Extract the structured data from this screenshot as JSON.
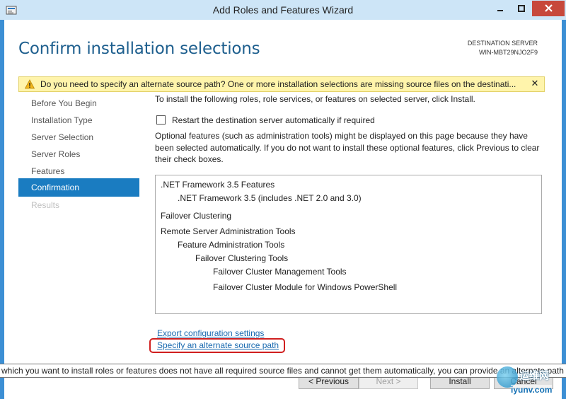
{
  "window": {
    "title": "Add Roles and Features Wizard",
    "minimize_icon": "minimize-icon",
    "maximize_icon": "maximize-icon",
    "close_icon": "close-icon"
  },
  "header": {
    "page_title": "Confirm installation selections",
    "destination_label": "DESTINATION SERVER",
    "destination_server": "WIN-MBT29NJO2F9"
  },
  "warning": {
    "text": "Do you need to specify an alternate source path? One or more installation selections are missing source files on the destinati...",
    "close_label": "✕",
    "color": "#fff4ab"
  },
  "nav": {
    "items": [
      {
        "label": "Before You Begin"
      },
      {
        "label": "Installation Type"
      },
      {
        "label": "Server Selection"
      },
      {
        "label": "Server Roles"
      },
      {
        "label": "Features"
      },
      {
        "label": "Confirmation"
      },
      {
        "label": "Results"
      }
    ],
    "active_color": "#1a7cc1"
  },
  "content": {
    "instruction": "To install the following roles, role services, or features on selected server, click Install.",
    "restart_label": "Restart the destination server automatically if required",
    "restart_checked": false,
    "optional_text": "Optional features (such as administration tools) might be displayed on this page because they have been selected automatically. If you do not want to install these optional features, click Previous to clear their check boxes.",
    "selections": [
      {
        "text": ".NET Framework 3.5 Features"
      },
      {
        "text": ".NET Framework 3.5 (includes .NET 2.0 and 3.0)"
      },
      {
        "text": "Failover Clustering"
      },
      {
        "text": "Remote Server Administration Tools"
      },
      {
        "text": "Feature Administration Tools"
      },
      {
        "text": "Failover Clustering Tools"
      },
      {
        "text": "Failover Cluster Management Tools"
      },
      {
        "text": "Failover Cluster Module for Windows PowerShell"
      }
    ],
    "export_link": "Export configuration settings",
    "alt_source_link": "Specify an alternate source path"
  },
  "tooltip": {
    "text": "which you want to install roles or features does not have all required source files and cannot get them automatically, you can provide an alternate path"
  },
  "buttons": {
    "previous": "< Previous",
    "next": "Next >",
    "install": "Install",
    "cancel": "Cancel"
  },
  "watermark": {
    "cn": "运维网",
    "url": "iyunv.com"
  }
}
